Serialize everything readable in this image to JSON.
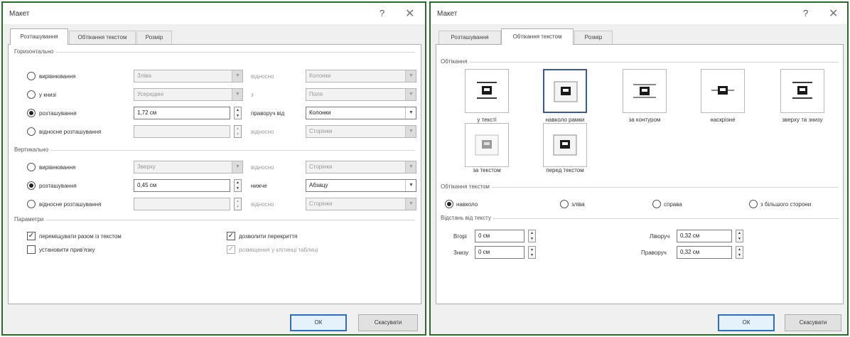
{
  "left_dialog": {
    "title": "Макет",
    "help_icon": "?",
    "close_icon": "✕",
    "tabs": [
      "Розташування",
      "Обтікання текстом",
      "Розмір"
    ],
    "horizontal": {
      "title": "Горизонтально",
      "rows": [
        {
          "label": "вирівнювання",
          "value": "Зліва",
          "relation_label": "відносно",
          "relation_value": "Колонки",
          "checked": false,
          "enabled": false
        },
        {
          "label": "у книзі",
          "value": "Усередині",
          "relation_label": "з",
          "relation_value": "Поля",
          "checked": false,
          "enabled": false
        },
        {
          "label": "розташування",
          "value": "1,72 см",
          "relation_label": "праворуч від",
          "relation_value": "Колонки",
          "checked": true,
          "enabled": true
        },
        {
          "label": "відносне розташування",
          "value": "",
          "relation_label": "відносно",
          "relation_value": "Сторінки",
          "checked": false,
          "enabled": false
        }
      ]
    },
    "vertical": {
      "title": "Вертикально",
      "rows": [
        {
          "label": "вирівнювання",
          "value": "Зверху",
          "relation_label": "відносно",
          "relation_value": "Сторінки",
          "checked": false,
          "enabled": false
        },
        {
          "label": "розташування",
          "value": "0,45 см",
          "relation_label": "нижче",
          "relation_value": "Абзацу",
          "checked": true,
          "enabled": true
        },
        {
          "label": "відносне розташування",
          "value": "",
          "relation_label": "відносно",
          "relation_value": "Сторінки",
          "checked": false,
          "enabled": false
        }
      ]
    },
    "options": {
      "title": "Параметри",
      "items": [
        {
          "label": "переміщувати разом із текстом",
          "checked": true,
          "enabled": true
        },
        {
          "label": "установити прив'язку",
          "checked": false,
          "enabled": true
        },
        {
          "label": "дозволити перекриття",
          "checked": true,
          "enabled": true
        },
        {
          "label": "розміщення у клітинці таблиці",
          "checked": true,
          "enabled": false
        }
      ]
    },
    "ok_label": "ОК",
    "cancel_label": "Скасувати"
  },
  "right_dialog": {
    "title": "Макет",
    "help_icon": "?",
    "close_icon": "✕",
    "tabs": [
      "Розташування",
      "Обтікання текстом",
      "Розмір"
    ],
    "wrapping": {
      "title": "Обтікання",
      "styles": [
        {
          "label": "у тексті",
          "selected": false
        },
        {
          "label": "навколо рамки",
          "selected": true
        },
        {
          "label": "за контуром",
          "selected": false
        },
        {
          "label": "наскрізне",
          "selected": false
        },
        {
          "label": "зверху та знизу",
          "selected": false
        },
        {
          "label": "за текстом",
          "selected": false
        },
        {
          "label": "перед текстом",
          "selected": false
        }
      ]
    },
    "wrap_text": {
      "title": "Обтікання текстом",
      "options": [
        {
          "label": "навколо",
          "checked": true
        },
        {
          "label": "зліва",
          "checked": false
        },
        {
          "label": "справа",
          "checked": false
        },
        {
          "label": "з більшого сторони",
          "checked": false
        }
      ]
    },
    "distance": {
      "title": "Відстань від тексту",
      "top_label": "Вгорі",
      "top_value": "0 см",
      "bottom_label": "Знизу",
      "bottom_value": "0 см",
      "left_label": "Ліворуч",
      "left_value": "0,32 см",
      "right_label": "Праворуч",
      "right_value": "0,32 см"
    },
    "ok_label": "ОК",
    "cancel_label": "Скасувати"
  }
}
